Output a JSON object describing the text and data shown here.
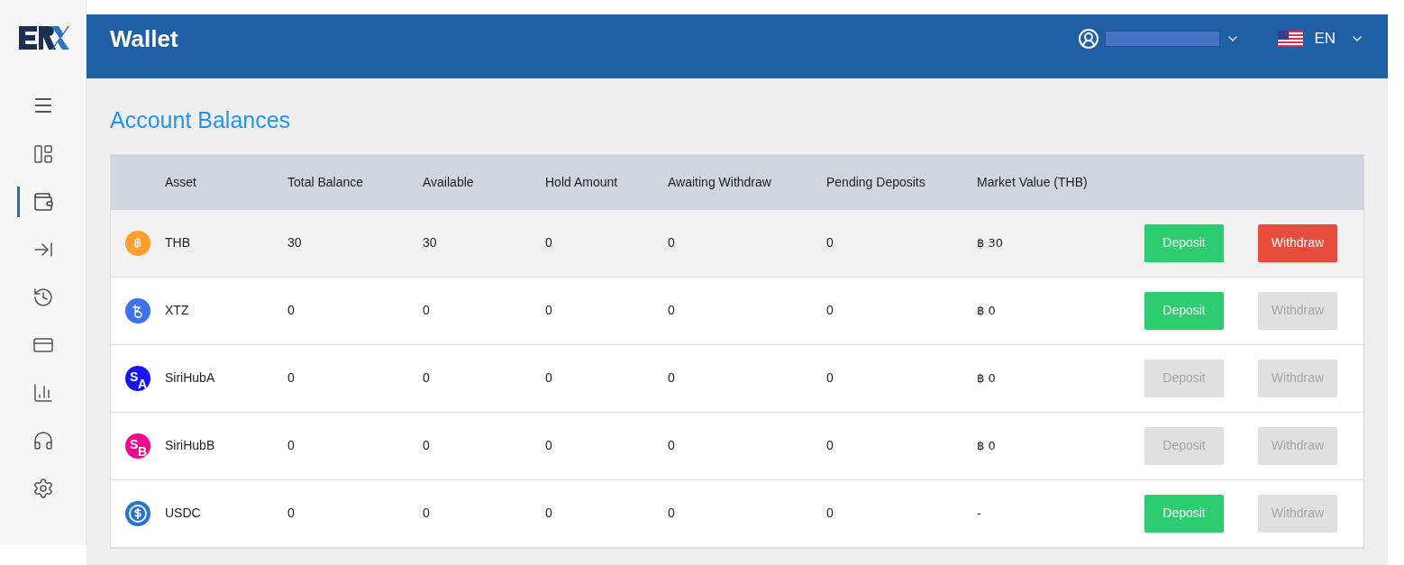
{
  "header": {
    "title": "Wallet",
    "language": "EN"
  },
  "sidebar": {
    "items": [
      {
        "kind": "dashboard",
        "selected": false
      },
      {
        "kind": "wallet",
        "selected": true
      },
      {
        "kind": "transfer",
        "selected": false
      },
      {
        "kind": "history",
        "selected": false
      },
      {
        "kind": "bank",
        "selected": false
      },
      {
        "kind": "chart",
        "selected": false
      },
      {
        "kind": "support",
        "selected": false
      },
      {
        "kind": "settings",
        "selected": false
      }
    ]
  },
  "page_title": "Account Balances",
  "table": {
    "columns": [
      "Asset",
      "Total Balance",
      "Available",
      "Hold Amount",
      "Awaiting Withdraw",
      "Pending Deposits",
      "Market Value (THB)"
    ],
    "rows": [
      {
        "kind": "glyph",
        "logo": [
          "฿"
        ],
        "color": "#ff9f2e",
        "highlighted": true,
        "cells": [
          "THB",
          "30",
          "30",
          "0",
          "0",
          "0",
          "฿ 30"
        ],
        "deposit": {
          "label": "Deposit",
          "disabled": false
        },
        "withdraw": {
          "label": "Withdraw",
          "disabled": false
        }
      },
      {
        "kind": "tezos",
        "logo": [],
        "color": "#3b73ef",
        "highlighted": false,
        "cells": [
          "XTZ",
          "0",
          "0",
          "0",
          "0",
          "0",
          "฿ 0"
        ],
        "deposit": {
          "label": "Deposit",
          "disabled": false
        },
        "withdraw": {
          "label": "Withdraw",
          "disabled": true
        }
      },
      {
        "kind": "letters",
        "logo": [
          "S",
          "A"
        ],
        "color": "#1a14f0",
        "highlighted": false,
        "cells": [
          "SiriHubA",
          "0",
          "0",
          "0",
          "0",
          "0",
          "฿ 0"
        ],
        "deposit": {
          "label": "Deposit",
          "disabled": true
        },
        "withdraw": {
          "label": "Withdraw",
          "disabled": true
        }
      },
      {
        "kind": "letters",
        "logo": [
          "S",
          "B"
        ],
        "color": "#f0088f",
        "highlighted": false,
        "cells": [
          "SiriHubB",
          "0",
          "0",
          "0",
          "0",
          "0",
          "฿ 0"
        ],
        "deposit": {
          "label": "Deposit",
          "disabled": true
        },
        "withdraw": {
          "label": "Withdraw",
          "disabled": true
        }
      },
      {
        "kind": "usdc",
        "logo": [],
        "color": "#2775ca",
        "highlighted": false,
        "cells": [
          "USDC",
          "0",
          "0",
          "0",
          "0",
          "0",
          "-"
        ],
        "deposit": {
          "label": "Deposit",
          "disabled": false
        },
        "withdraw": {
          "label": "Withdraw",
          "disabled": true
        }
      }
    ]
  }
}
